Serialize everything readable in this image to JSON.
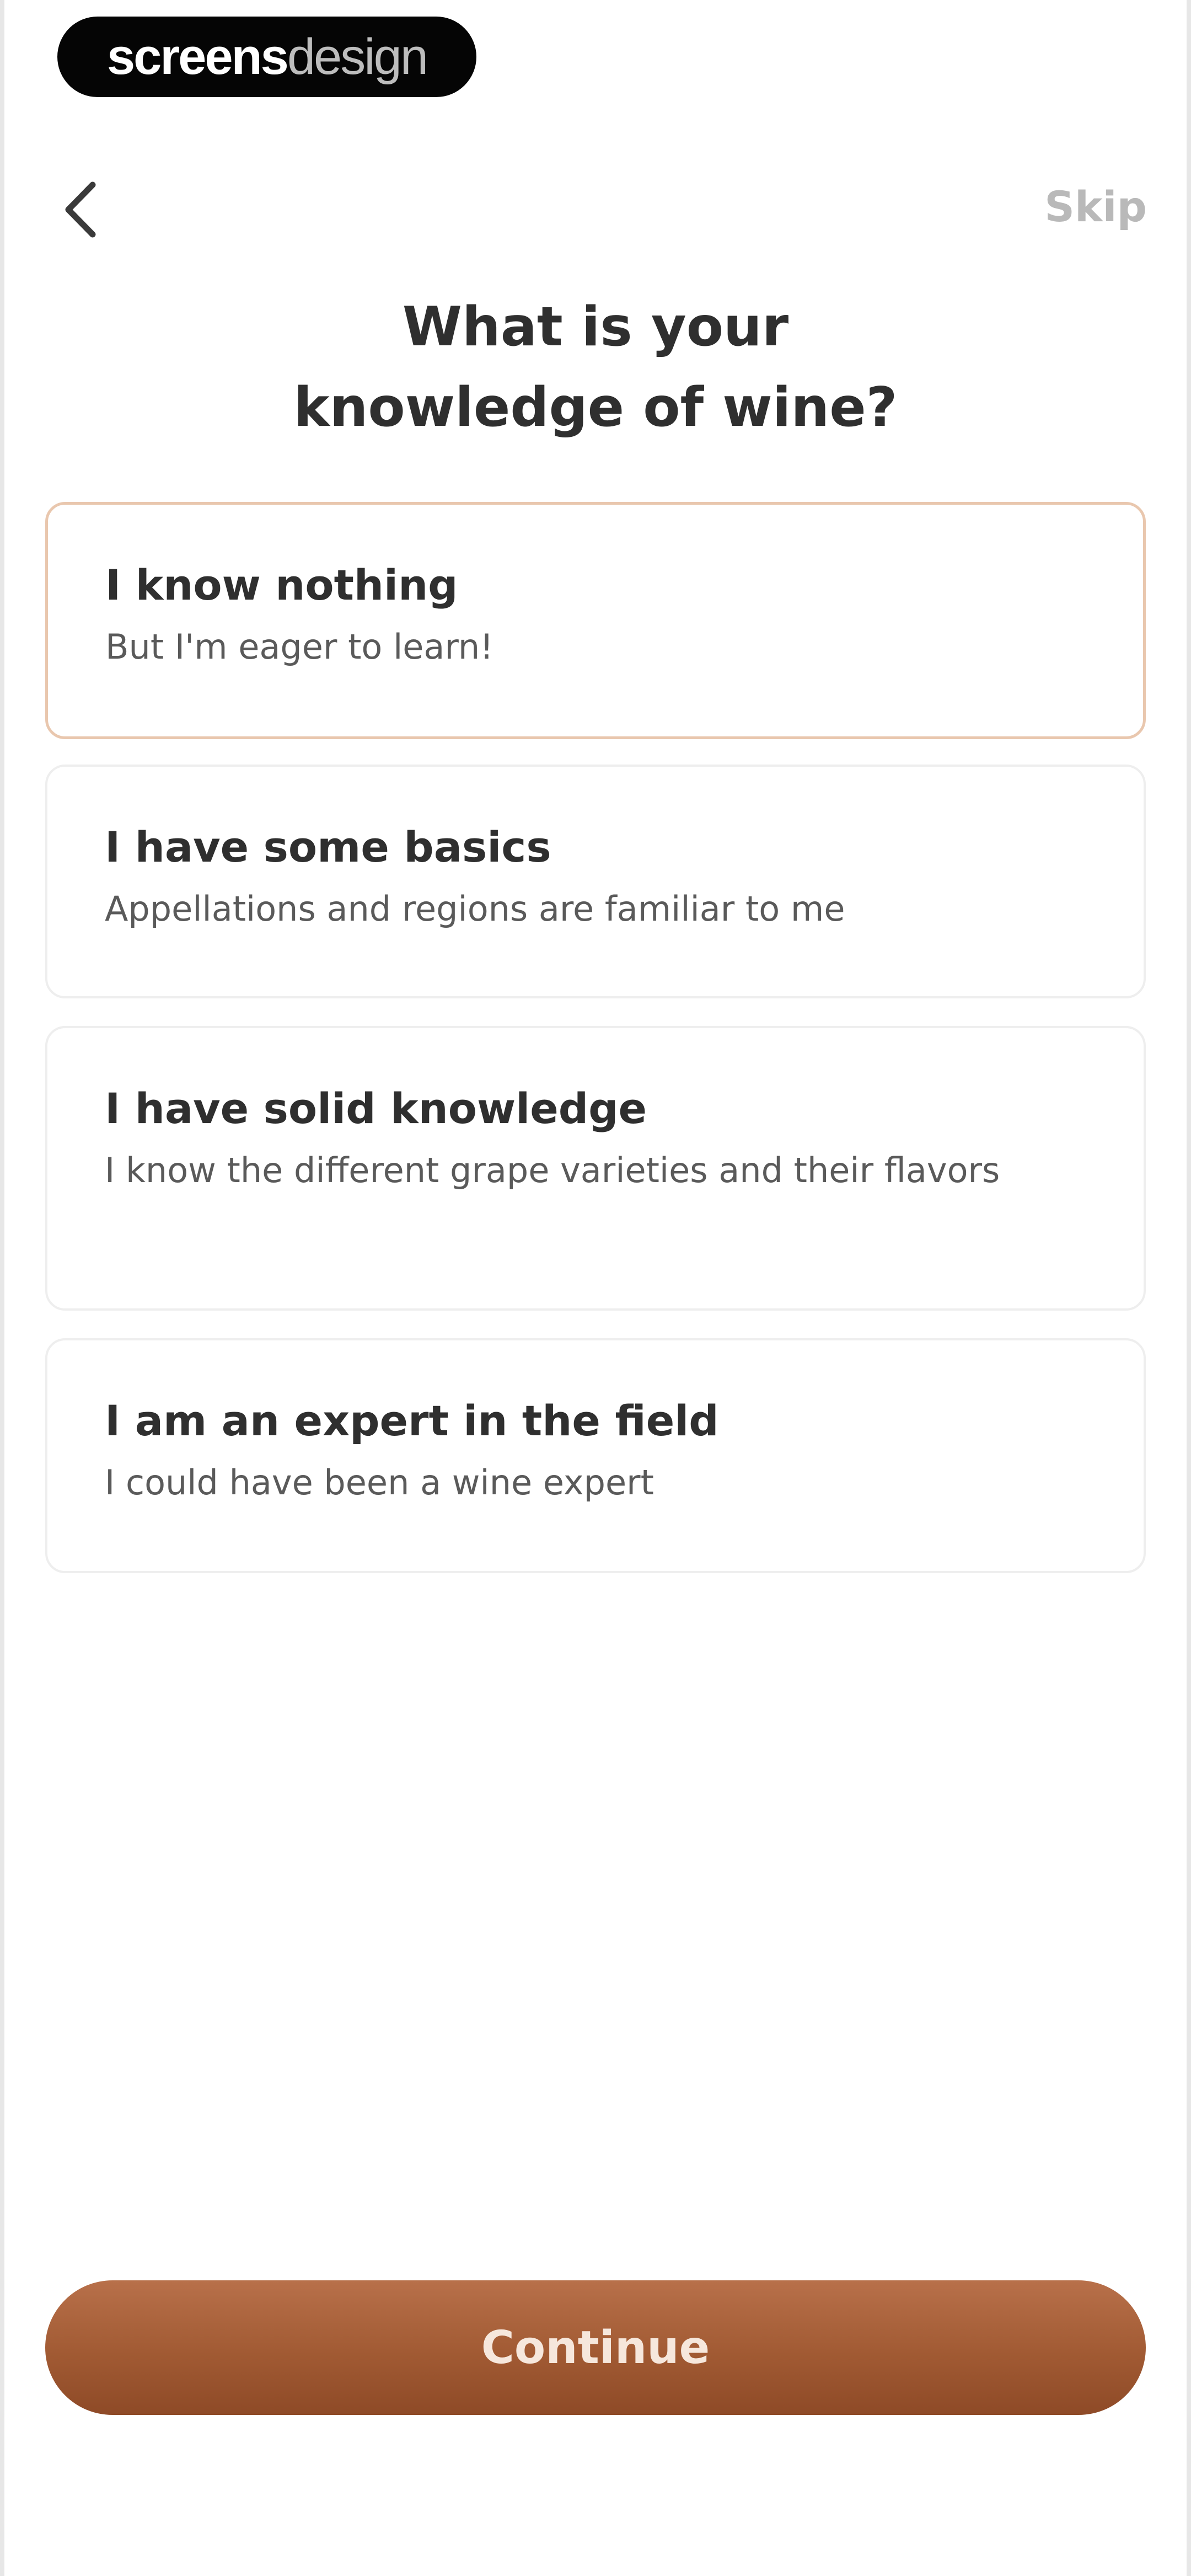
{
  "brand": {
    "bold": "screens",
    "light": "design"
  },
  "nav": {
    "skip_label": "Skip"
  },
  "question": {
    "title": "What is your\nknowledge of wine?"
  },
  "options": [
    {
      "title": "I know nothing",
      "subtitle": "But I'm eager to learn!",
      "selected": true
    },
    {
      "title": "I have some basics",
      "subtitle": "Appellations and regions are familiar to me",
      "selected": false
    },
    {
      "title": "I have solid knowledge",
      "subtitle": "I know the different grape varieties and their flavors",
      "selected": false
    },
    {
      "title": "I am an expert in the field",
      "subtitle": "I could have been a wine expert",
      "selected": false
    }
  ],
  "continue_label": "Continue",
  "colors": {
    "accent": "#a15a33",
    "selected_border": "#e9c7ae",
    "text": "#2f2f2f",
    "muted": "#b9b9b9"
  },
  "icons": {
    "back": "chevron-left-icon"
  }
}
